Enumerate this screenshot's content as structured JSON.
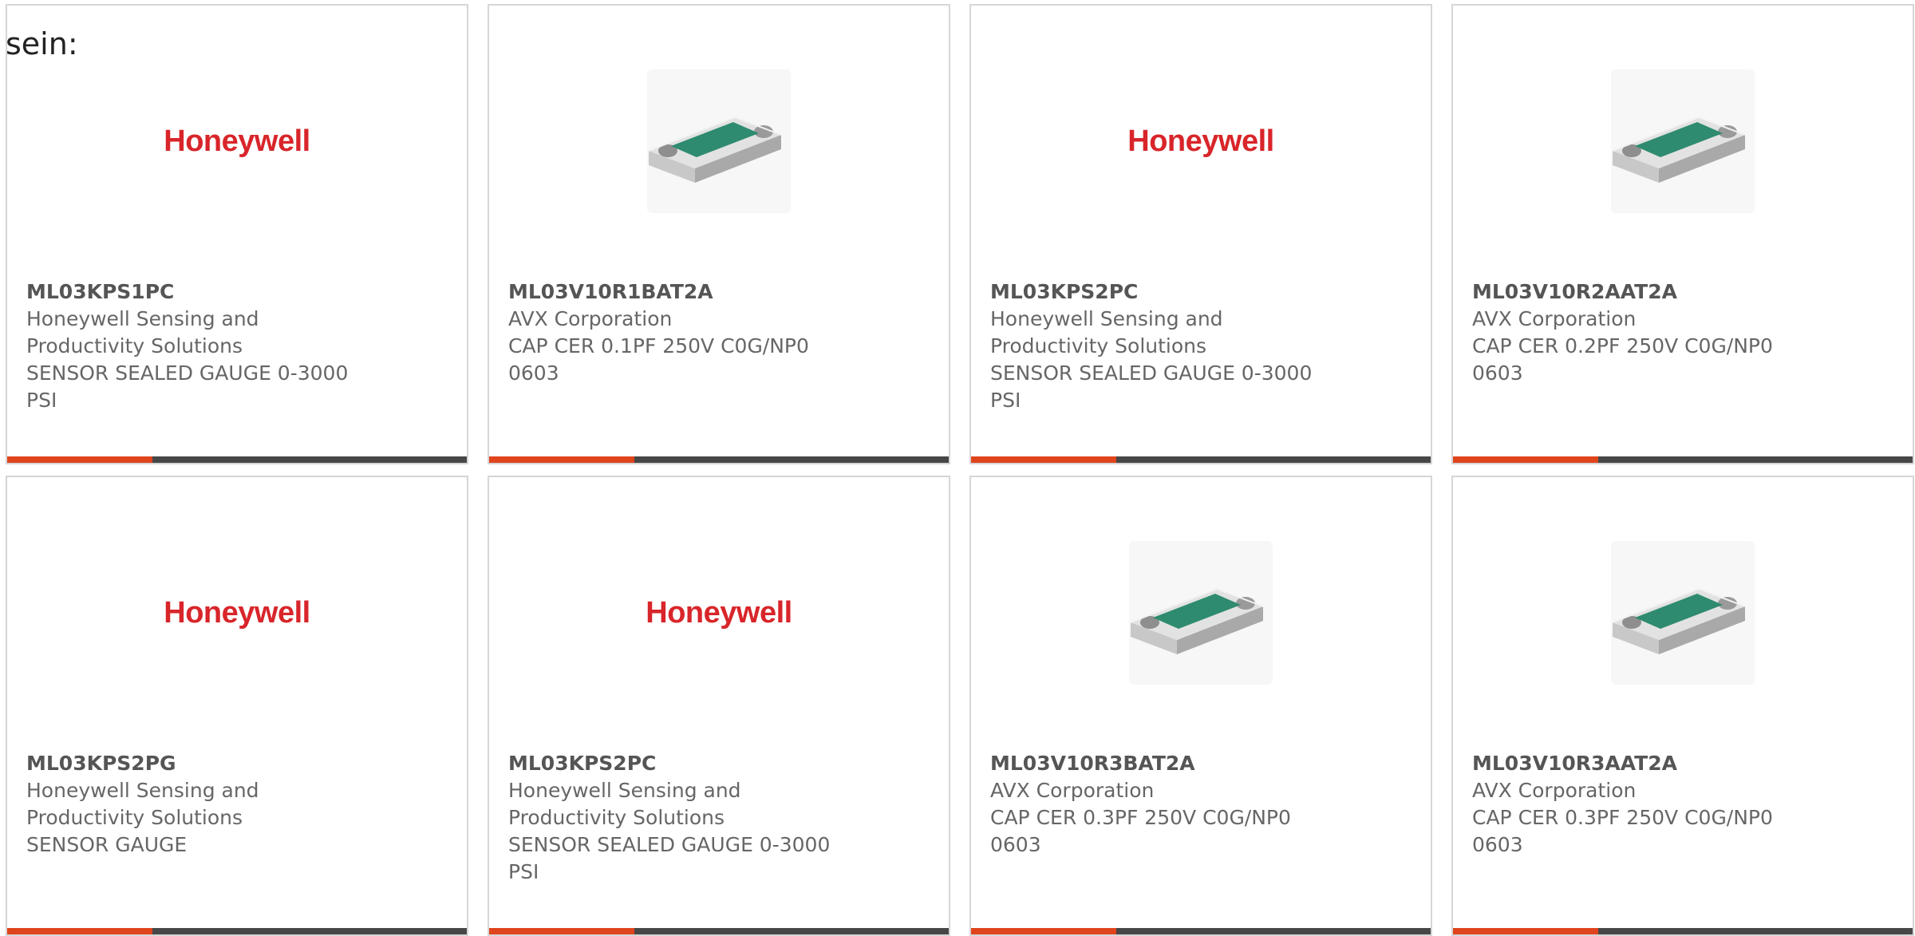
{
  "intro_text": "sein:",
  "colors": {
    "accent_orange": "#e0441c",
    "accent_dark": "#474747",
    "brand_red": "#d8252a",
    "chip_green": "#2e8b6f"
  },
  "cards": [
    {
      "image": "honeywell-logo",
      "logo_text": "Honeywell",
      "part_number": "ML03KPS1PC",
      "manufacturer_line1": "Honeywell Sensing and",
      "manufacturer_line2": "Productivity Solutions",
      "description_line1": "SENSOR SEALED GAUGE 0-3000",
      "description_line2": "PSI"
    },
    {
      "image": "smd-capacitor-chip",
      "logo_text": "",
      "part_number": "ML03V10R1BAT2A",
      "manufacturer_line1": "AVX Corporation",
      "manufacturer_line2": "",
      "description_line1": "CAP CER 0.1PF 250V C0G/NP0",
      "description_line2": "0603"
    },
    {
      "image": "honeywell-logo",
      "logo_text": "Honeywell",
      "part_number": "ML03KPS2PC",
      "manufacturer_line1": "Honeywell Sensing and",
      "manufacturer_line2": "Productivity Solutions",
      "description_line1": "SENSOR SEALED GAUGE 0-3000",
      "description_line2": "PSI"
    },
    {
      "image": "smd-capacitor-chip",
      "logo_text": "",
      "part_number": "ML03V10R2AAT2A",
      "manufacturer_line1": "AVX Corporation",
      "manufacturer_line2": "",
      "description_line1": "CAP CER 0.2PF 250V C0G/NP0",
      "description_line2": "0603"
    },
    {
      "image": "honeywell-logo",
      "logo_text": "Honeywell",
      "part_number": "ML03KPS2PG",
      "manufacturer_line1": "Honeywell Sensing and",
      "manufacturer_line2": "Productivity Solutions",
      "description_line1": "SENSOR GAUGE",
      "description_line2": ""
    },
    {
      "image": "honeywell-logo",
      "logo_text": "Honeywell",
      "part_number": "ML03KPS2PC",
      "manufacturer_line1": "Honeywell Sensing and",
      "manufacturer_line2": "Productivity Solutions",
      "description_line1": "SENSOR SEALED GAUGE 0-3000",
      "description_line2": "PSI"
    },
    {
      "image": "smd-capacitor-chip",
      "logo_text": "",
      "part_number": "ML03V10R3BAT2A",
      "manufacturer_line1": "AVX Corporation",
      "manufacturer_line2": "",
      "description_line1": "CAP CER 0.3PF 250V C0G/NP0",
      "description_line2": "0603"
    },
    {
      "image": "smd-capacitor-chip",
      "logo_text": "",
      "part_number": "ML03V10R3AAT2A",
      "manufacturer_line1": "AVX Corporation",
      "manufacturer_line2": "",
      "description_line1": "CAP CER 0.3PF 250V C0G/NP0",
      "description_line2": "0603"
    }
  ]
}
